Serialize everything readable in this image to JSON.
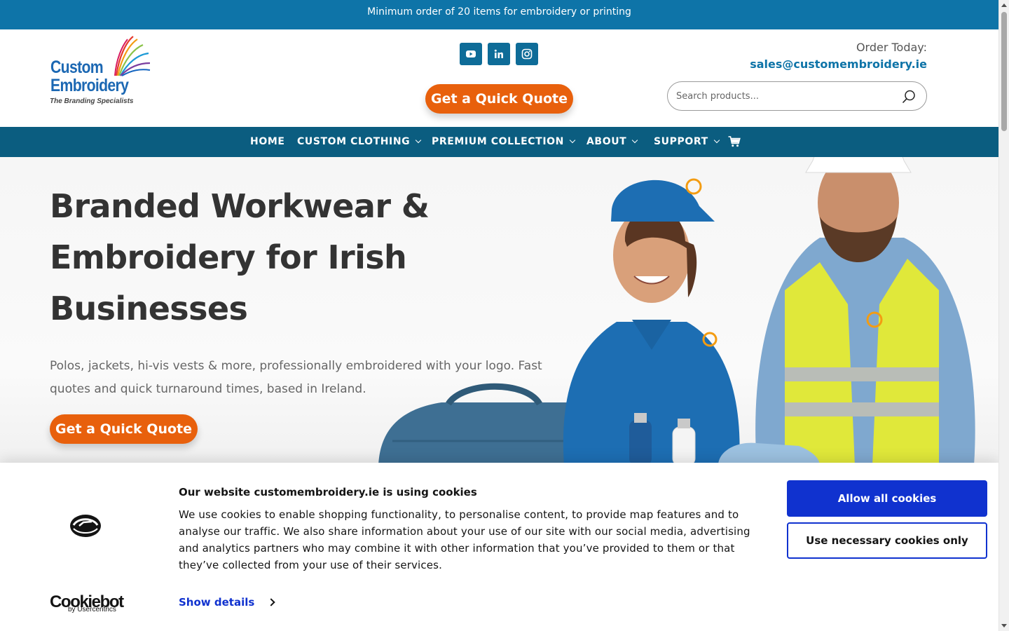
{
  "announcement": "Minimum order of 20 items for embroidery or printing",
  "logo": {
    "line1": "Custom",
    "line2": "Embroidery",
    "tagline": "The Branding Specialists"
  },
  "social": [
    "youtube-icon",
    "linkedin-icon",
    "instagram-icon"
  ],
  "header": {
    "quote_button": "Get a Quick Quote",
    "order_label": "Order Today:",
    "order_email": "sales@customembroidery.ie",
    "search_placeholder": "Search products..."
  },
  "nav": {
    "items": [
      {
        "label": "HOME",
        "dropdown": false
      },
      {
        "label": "CUSTOM CLOTHING",
        "dropdown": true
      },
      {
        "label": "PREMIUM COLLECTION",
        "dropdown": true
      },
      {
        "label": "ABOUT",
        "dropdown": true
      },
      {
        "label": "SUPPORT",
        "dropdown": true
      }
    ],
    "cart_icon": "cart-icon"
  },
  "hero": {
    "title": "Branded Workwear & Embroidery for Irish Businesses",
    "subtitle": "Polos, jackets, hi-vis vests & more, professionally embroidered with your logo. Fast quotes and quick turnaround times, based in Ireland.",
    "cta": "Get a Quick Quote"
  },
  "cookie": {
    "title": "Our website customembroidery.ie is using cookies",
    "text": "We use cookies to enable shopping functionality, to personalise content, to provide map features and to analyse our traffic. We also share information about your use of our site with our social media, advertising and analytics partners who may combine it with other information that you’ve provided to them or that they’ve collected from your use of their services.",
    "show_details": "Show details",
    "allow_all": "Allow all cookies",
    "necessary_only": "Use necessary cookies only",
    "brand": "Cookiebot",
    "brand_by": "by Usercentrics"
  },
  "colors": {
    "brand_blue": "#0e74a8",
    "nav_blue": "#0b5d80",
    "cta_orange": "#e8600c",
    "cookie_blue": "#1032cf"
  }
}
